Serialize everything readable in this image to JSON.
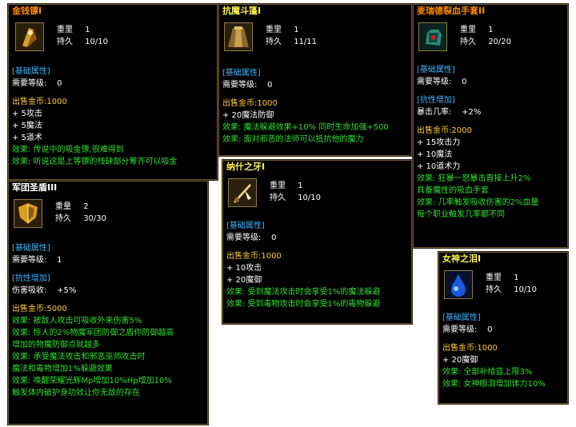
{
  "cards": [
    {
      "title": "金钱镖I",
      "weight_label": "重里",
      "weight": "1",
      "durability_label": "持久",
      "durability": "10/10",
      "base_header": "[基础属性]",
      "level_label": "需要等级:",
      "level": "0",
      "price_label": "出售金币:",
      "price": "1000",
      "stats": [
        "+ 5攻击",
        "+ 5魔法",
        "+ 5道术"
      ],
      "effects": [
        "效果: 传说中的吸金镖,很难得到",
        "效果: 听说这是上等镖的残缺部分筹齐可以吸金"
      ]
    },
    {
      "title": "抗魔斗篷I",
      "weight_label": "重里",
      "weight": "1",
      "durability_label": "持久",
      "durability": "11/11",
      "base_header": "[基础属性]",
      "level_label": "需要等级:",
      "level": "0",
      "price_label": "出售金币:",
      "price": "1000",
      "stats": [
        "+ 20魔法防御"
      ],
      "effects": [
        "效果: 魔法躲避效果+10% 同时生命加强+500",
        "效果: 面对邪恶的法师可以抵抗他的魔力"
      ]
    },
    {
      "title": "麦瑞德裂血手套II",
      "weight_label": "重里",
      "weight": "1",
      "durability_label": "持久",
      "durability": "20/20",
      "base_header": "[基础属性]",
      "level_label": "需要等级:",
      "level": "0",
      "resist_header": "[抗性增加]",
      "resist_label": "暴击几率:",
      "resist_value": "+2%",
      "price_label": "出售金币:",
      "price": "2000",
      "stats": [
        "+ 15攻击力",
        "+ 10魔法",
        "+ 10道术力"
      ],
      "effects": [
        "效果: 狂暴一怒暴击直接上升2%",
        "具备魔性的吸血手套",
        "效果: 几率触发吸收伤害的2%血量",
        "每个职业触发几率都不同"
      ]
    },
    {
      "title": "军团圣盾III",
      "weight_label": "重量",
      "weight": "2",
      "durability_label": "持久",
      "durability": "30/30",
      "base_header": "[基础属性]",
      "level_label": "需要等级:",
      "level": "1",
      "resist_header": "[抗性增加]",
      "resist_label": "伤害吸收:",
      "resist_value": "+5%",
      "price_label": "出售金币:",
      "price": "5000",
      "effects": [
        "效果: 被敌人攻击可吸收外来伤害5%",
        "效果: 惊人的2%物魔军团防御之盾你防御越高",
        "增加的物魔防御点就越多",
        "效果: 承受魔法攻击和邪恶巫师攻击时",
        "魔法和毒物增加1%躲避效果",
        "效果: 唤醒荣耀光辉Mp增加10%Hp增加10%",
        "触发体内破护身功效让你无敌的存在"
      ]
    },
    {
      "title": "纳什之牙I",
      "weight_label": "重里",
      "weight": "1",
      "durability_label": "持久",
      "durability": "10/10",
      "base_header": "[基础属性]",
      "level_label": "需要等级:",
      "level": "0",
      "price_label": "出售金币:",
      "price": "1000",
      "stats": [
        "+ 10攻击",
        "+ 20魔御"
      ],
      "effects": [
        "效果: 受到魔法攻击时会享受1%的魔法躲避",
        "效果: 受到毒物攻击时会享受1%的毒物躲避"
      ]
    },
    {
      "title": "女神之泪I",
      "weight_label": "重里",
      "weight": "1",
      "durability_label": "持久",
      "durability": "10/10",
      "base_header": "[基础属性]",
      "level_label": "需要等级:",
      "level": "0",
      "price_label": "出售金币:",
      "price": "1000",
      "stats": [
        "+ 20魔御"
      ],
      "effects": [
        "效果: 全部补给蓝上限3%",
        "效果: 女神眼泪增加体力10%"
      ]
    }
  ],
  "colors": {
    "title_orange": "#ff8a00",
    "title_yellow": "#fff14a",
    "header_blue": "#3fb3ff",
    "price_gold": "#ffcc33",
    "effect_green": "#2ee02e",
    "border": "#6e5a2e"
  },
  "icons": [
    "dart-icon",
    "cloak-icon",
    "gauntlet-icon",
    "shield-icon",
    "fang-icon",
    "teardrop-icon"
  ]
}
